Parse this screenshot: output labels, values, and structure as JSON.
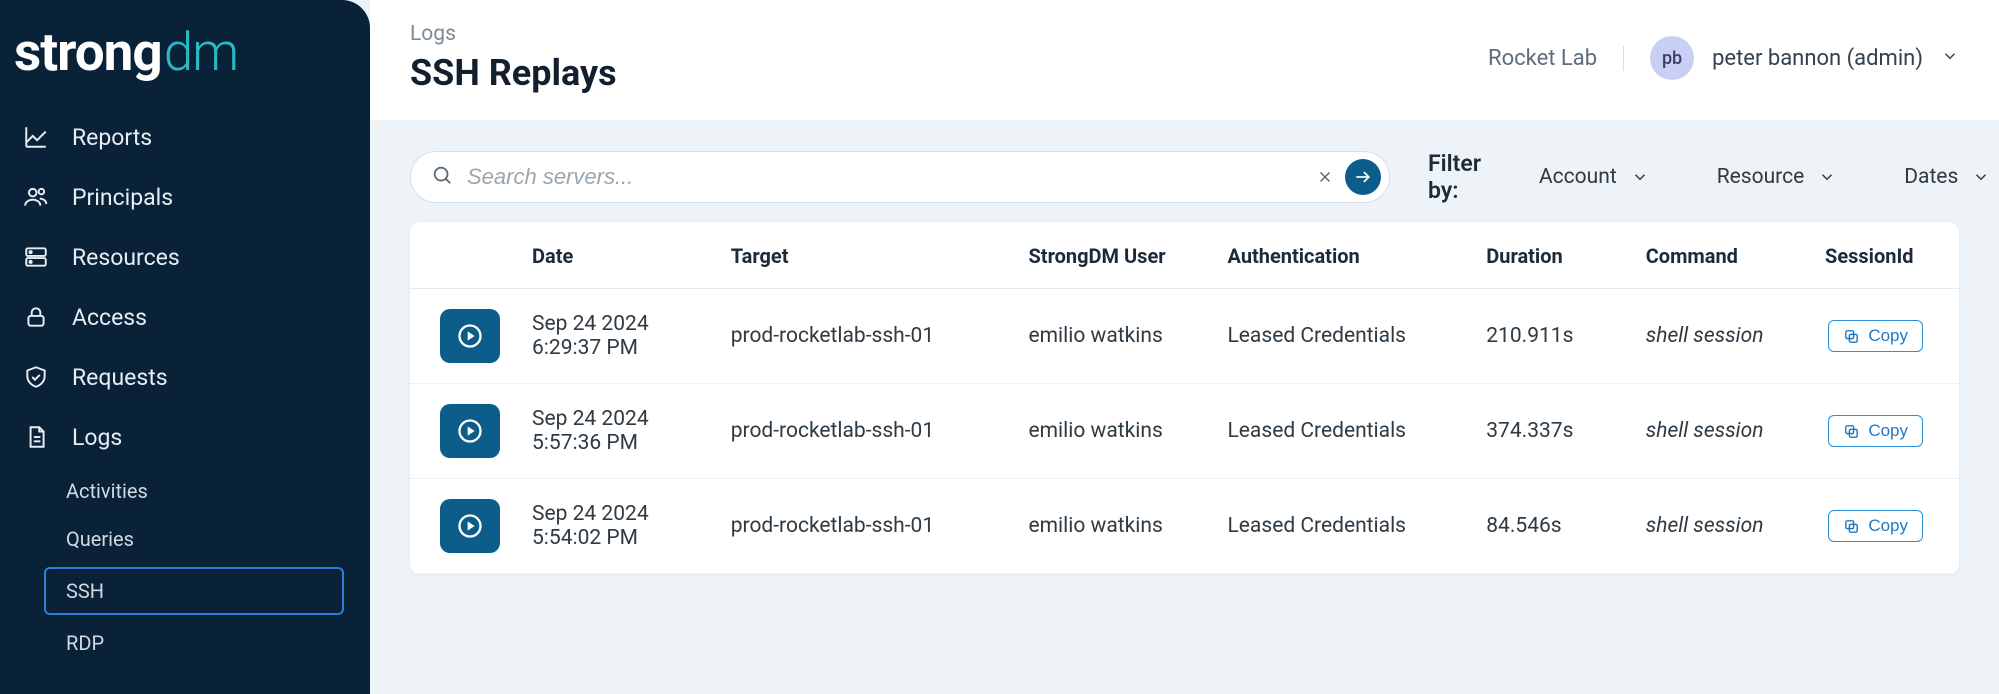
{
  "logo": {
    "strong": "strong",
    "dm": "dm"
  },
  "sidebar": {
    "items": [
      {
        "label": "Reports"
      },
      {
        "label": "Principals"
      },
      {
        "label": "Resources"
      },
      {
        "label": "Access"
      },
      {
        "label": "Requests"
      },
      {
        "label": "Logs"
      }
    ],
    "log_subitems": [
      {
        "label": "Activities"
      },
      {
        "label": "Queries"
      },
      {
        "label": "SSH",
        "active": true
      },
      {
        "label": "RDP"
      }
    ]
  },
  "header": {
    "breadcrumb": "Logs",
    "title": "SSH Replays",
    "org": "Rocket Lab",
    "avatar_initials": "pb",
    "user_display": "peter bannon (admin)"
  },
  "toolbar": {
    "search_placeholder": "Search servers...",
    "filter_label": "Filter by:",
    "filters": [
      {
        "label": "Account"
      },
      {
        "label": "Resource"
      },
      {
        "label": "Dates"
      }
    ]
  },
  "table": {
    "columns": [
      "",
      "Date",
      "Target",
      "StrongDM User",
      "Authentication",
      "Duration",
      "Command",
      "SessionId"
    ],
    "copy_label": "Copy",
    "rows": [
      {
        "date_l1": "Sep 24 2024",
        "date_l2": "6:29:37 PM",
        "target": "prod-rocketlab-ssh-01",
        "user": "emilio watkins",
        "auth": "Leased Credentials",
        "duration": "210.911s",
        "command": "shell session"
      },
      {
        "date_l1": "Sep 24 2024",
        "date_l2": "5:57:36 PM",
        "target": "prod-rocketlab-ssh-01",
        "user": "emilio watkins",
        "auth": "Leased Credentials",
        "duration": "374.337s",
        "command": "shell session"
      },
      {
        "date_l1": "Sep 24 2024",
        "date_l2": "5:54:02 PM",
        "target": "prod-rocketlab-ssh-01",
        "user": "emilio watkins",
        "auth": "Leased Credentials",
        "duration": "84.546s",
        "command": "shell session"
      }
    ]
  }
}
